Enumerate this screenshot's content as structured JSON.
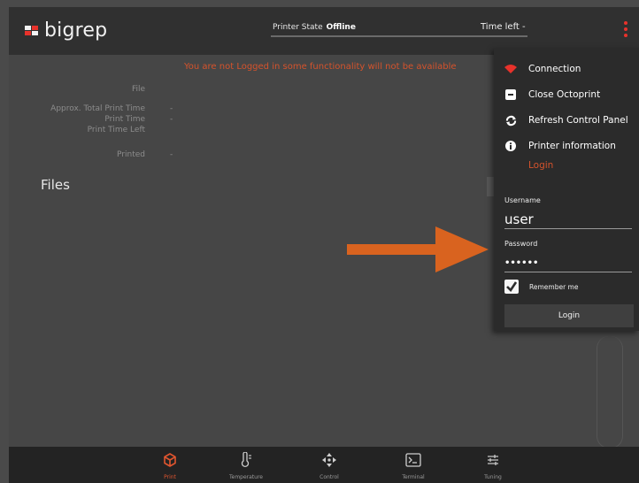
{
  "header": {
    "logo_text": "bigrep",
    "printer_state_label": "Printer State",
    "printer_state_value": "Offline",
    "time_left": "Time left -"
  },
  "main": {
    "warning": "You are not Logged in some functionality will not be available",
    "info": [
      {
        "label": "File",
        "value": ""
      },
      {
        "label": "Approx. Total Print Time",
        "value": "-"
      },
      {
        "label": "Print Time",
        "value": "-"
      },
      {
        "label": "Print Time Left",
        "value": ""
      },
      {
        "label": "Printed",
        "value": "-"
      }
    ],
    "files_title": "Files"
  },
  "menu": {
    "items": [
      {
        "label": "Connection",
        "icon": "wifi-icon"
      },
      {
        "label": "Close Octoprint",
        "icon": "minus-square-icon"
      },
      {
        "label": "Refresh Control Panel",
        "icon": "refresh-icon"
      },
      {
        "label": "Printer information",
        "icon": "info-icon"
      }
    ],
    "login_link": "Login",
    "username_label": "Username",
    "username_value": "user",
    "password_label": "Password",
    "password_value": "••••••",
    "remember_label": "Remember me",
    "login_button": "Login"
  },
  "bottom_nav": [
    {
      "label": "Print",
      "icon": "cube-icon"
    },
    {
      "label": "Temperature",
      "icon": "thermometer-icon"
    },
    {
      "label": "Control",
      "icon": "move-arrows-icon"
    },
    {
      "label": "Terminal",
      "icon": "terminal-icon"
    },
    {
      "label": "Tuning",
      "icon": "sliders-icon"
    }
  ],
  "colors": {
    "accent": "#d5532c",
    "logo_red": "#e8322b",
    "header_bg": "#303030",
    "content_bg": "#464646",
    "menu_bg": "#2b2b2b"
  }
}
